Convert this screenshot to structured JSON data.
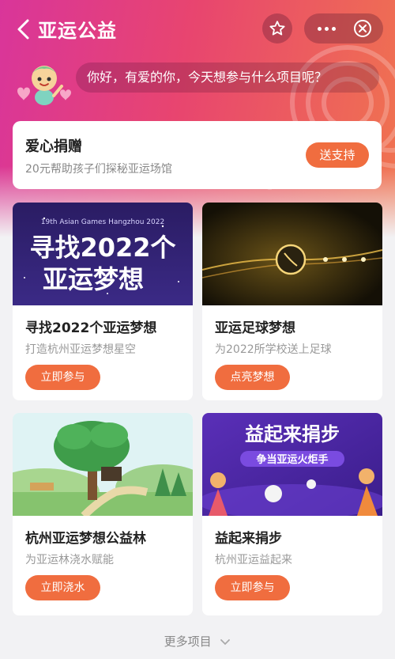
{
  "header": {
    "title": "亚运公益",
    "icons": {
      "back": "chevron-left-icon",
      "favorite": "star-icon",
      "more": "more-dots-icon",
      "close": "close-circle-icon"
    }
  },
  "greeting": "你好，有爱的你，今天想参与什么项目呢？",
  "donation": {
    "title": "爱心捐赠",
    "subtitle": "20元帮助孩子们探秘亚运场馆",
    "button": "送支持"
  },
  "projects": [
    {
      "title": "寻找2022个亚运梦想",
      "subtitle": "打造杭州亚运梦想星空",
      "button": "立即参与",
      "image_caption": "19th Asian Games Hangzhou 2022",
      "image_line1": "寻找2022个",
      "image_line2": "亚运梦想"
    },
    {
      "title": "亚运足球梦想",
      "subtitle": "为2022所学校送上足球",
      "button": "点亮梦想"
    },
    {
      "title": "杭州亚运梦想公益林",
      "subtitle": "为亚运林浇水赋能",
      "button": "立即浇水"
    },
    {
      "title": "益起来捐步",
      "subtitle": "杭州亚运益起来",
      "button": "立即参与",
      "image_line1": "益起来捐步",
      "image_line2": "争当亚运火炬手"
    }
  ],
  "more_label": "更多项目",
  "colors": {
    "accent": "#f06d3f",
    "hero_start": "#d9359a",
    "hero_end": "#f0744f"
  }
}
